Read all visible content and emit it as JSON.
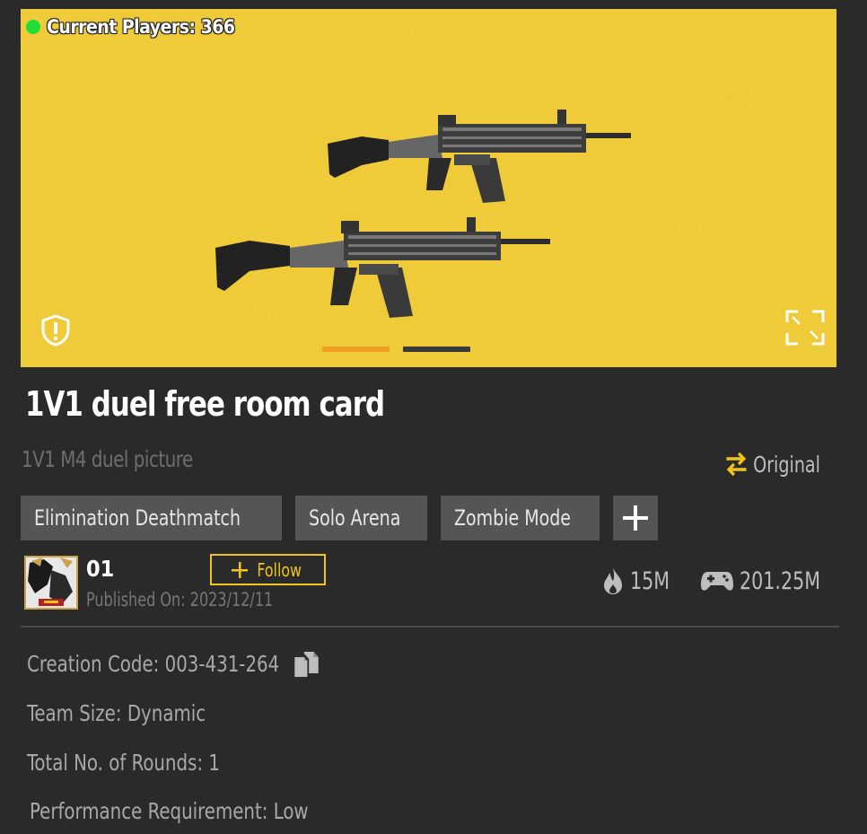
{
  "banner": {
    "current_players_label": "Current Players: 366",
    "background_color": "#efcb3a",
    "online_dot_color": "#22dd33",
    "pager": {
      "active_index": 0,
      "count": 2,
      "active_color": "#f0a020",
      "inactive_color": "#3a3a3a"
    },
    "icons": [
      "shield-warning-icon",
      "fullscreen-icon"
    ]
  },
  "title": "1V1 duel free room card",
  "subtitle": "1V1 M4 duel picture",
  "original_label": "Original",
  "tags": [
    "Elimination Deathmatch",
    "Solo Arena",
    "Zombie Mode"
  ],
  "author": {
    "name": "01",
    "follow_label": "Follow",
    "published": "Published On: 2023/12/11"
  },
  "stats": {
    "heat": "15M",
    "plays": "201.25M"
  },
  "details": {
    "creation_code": "Creation Code: 003-431-264",
    "team_size": "Team Size: Dynamic",
    "rounds": "Total No. of Rounds: 1",
    "performance": "Performance Requirement: Low"
  },
  "accent_color": "#f2c41a"
}
